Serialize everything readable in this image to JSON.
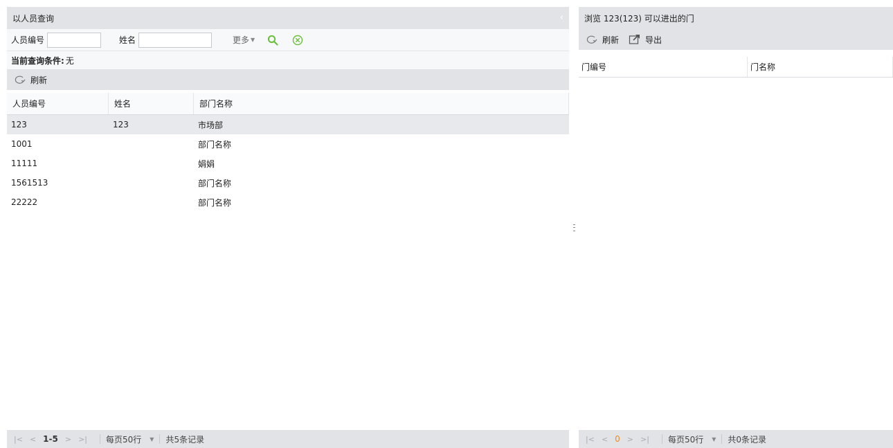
{
  "left": {
    "title": "以人员查询",
    "collapse_glyph": "‹",
    "search": {
      "pin_label": "人员编号",
      "pin_value": "",
      "name_label": "姓名",
      "name_value": "",
      "more_label": "更多",
      "search_icon": "search-icon",
      "clear_icon": "clear-icon"
    },
    "condition": {
      "label": "当前查询条件:",
      "value": "无"
    },
    "toolbar": {
      "refresh_label": "刷新"
    },
    "columns": [
      "人员编号",
      "姓名",
      "部门名称"
    ],
    "rows": [
      {
        "pin": "123",
        "name": "123",
        "dept": "市场部"
      },
      {
        "pin": "1001",
        "name": "",
        "dept": "部门名称"
      },
      {
        "pin": "11111",
        "name": "",
        "dept": "娟娟"
      },
      {
        "pin": "1561513",
        "name": "",
        "dept": "部门名称"
      },
      {
        "pin": "22222",
        "name": "",
        "dept": "部门名称"
      }
    ],
    "pager": {
      "range": "1-5",
      "page_size": "每页50行",
      "total": "共5条记录"
    }
  },
  "right": {
    "title": "浏览 123(123) 可以进出的门",
    "toolbar": {
      "refresh_label": "刷新",
      "export_label": "导出"
    },
    "columns": [
      "门编号",
      "门名称"
    ],
    "pager": {
      "range": "0",
      "page_size": "每页50行",
      "total": "共0条记录"
    }
  },
  "colors": {
    "accent_green": "#6abf3c",
    "header_bg": "#e1e3e7",
    "pager_orange": "#f08a24"
  }
}
